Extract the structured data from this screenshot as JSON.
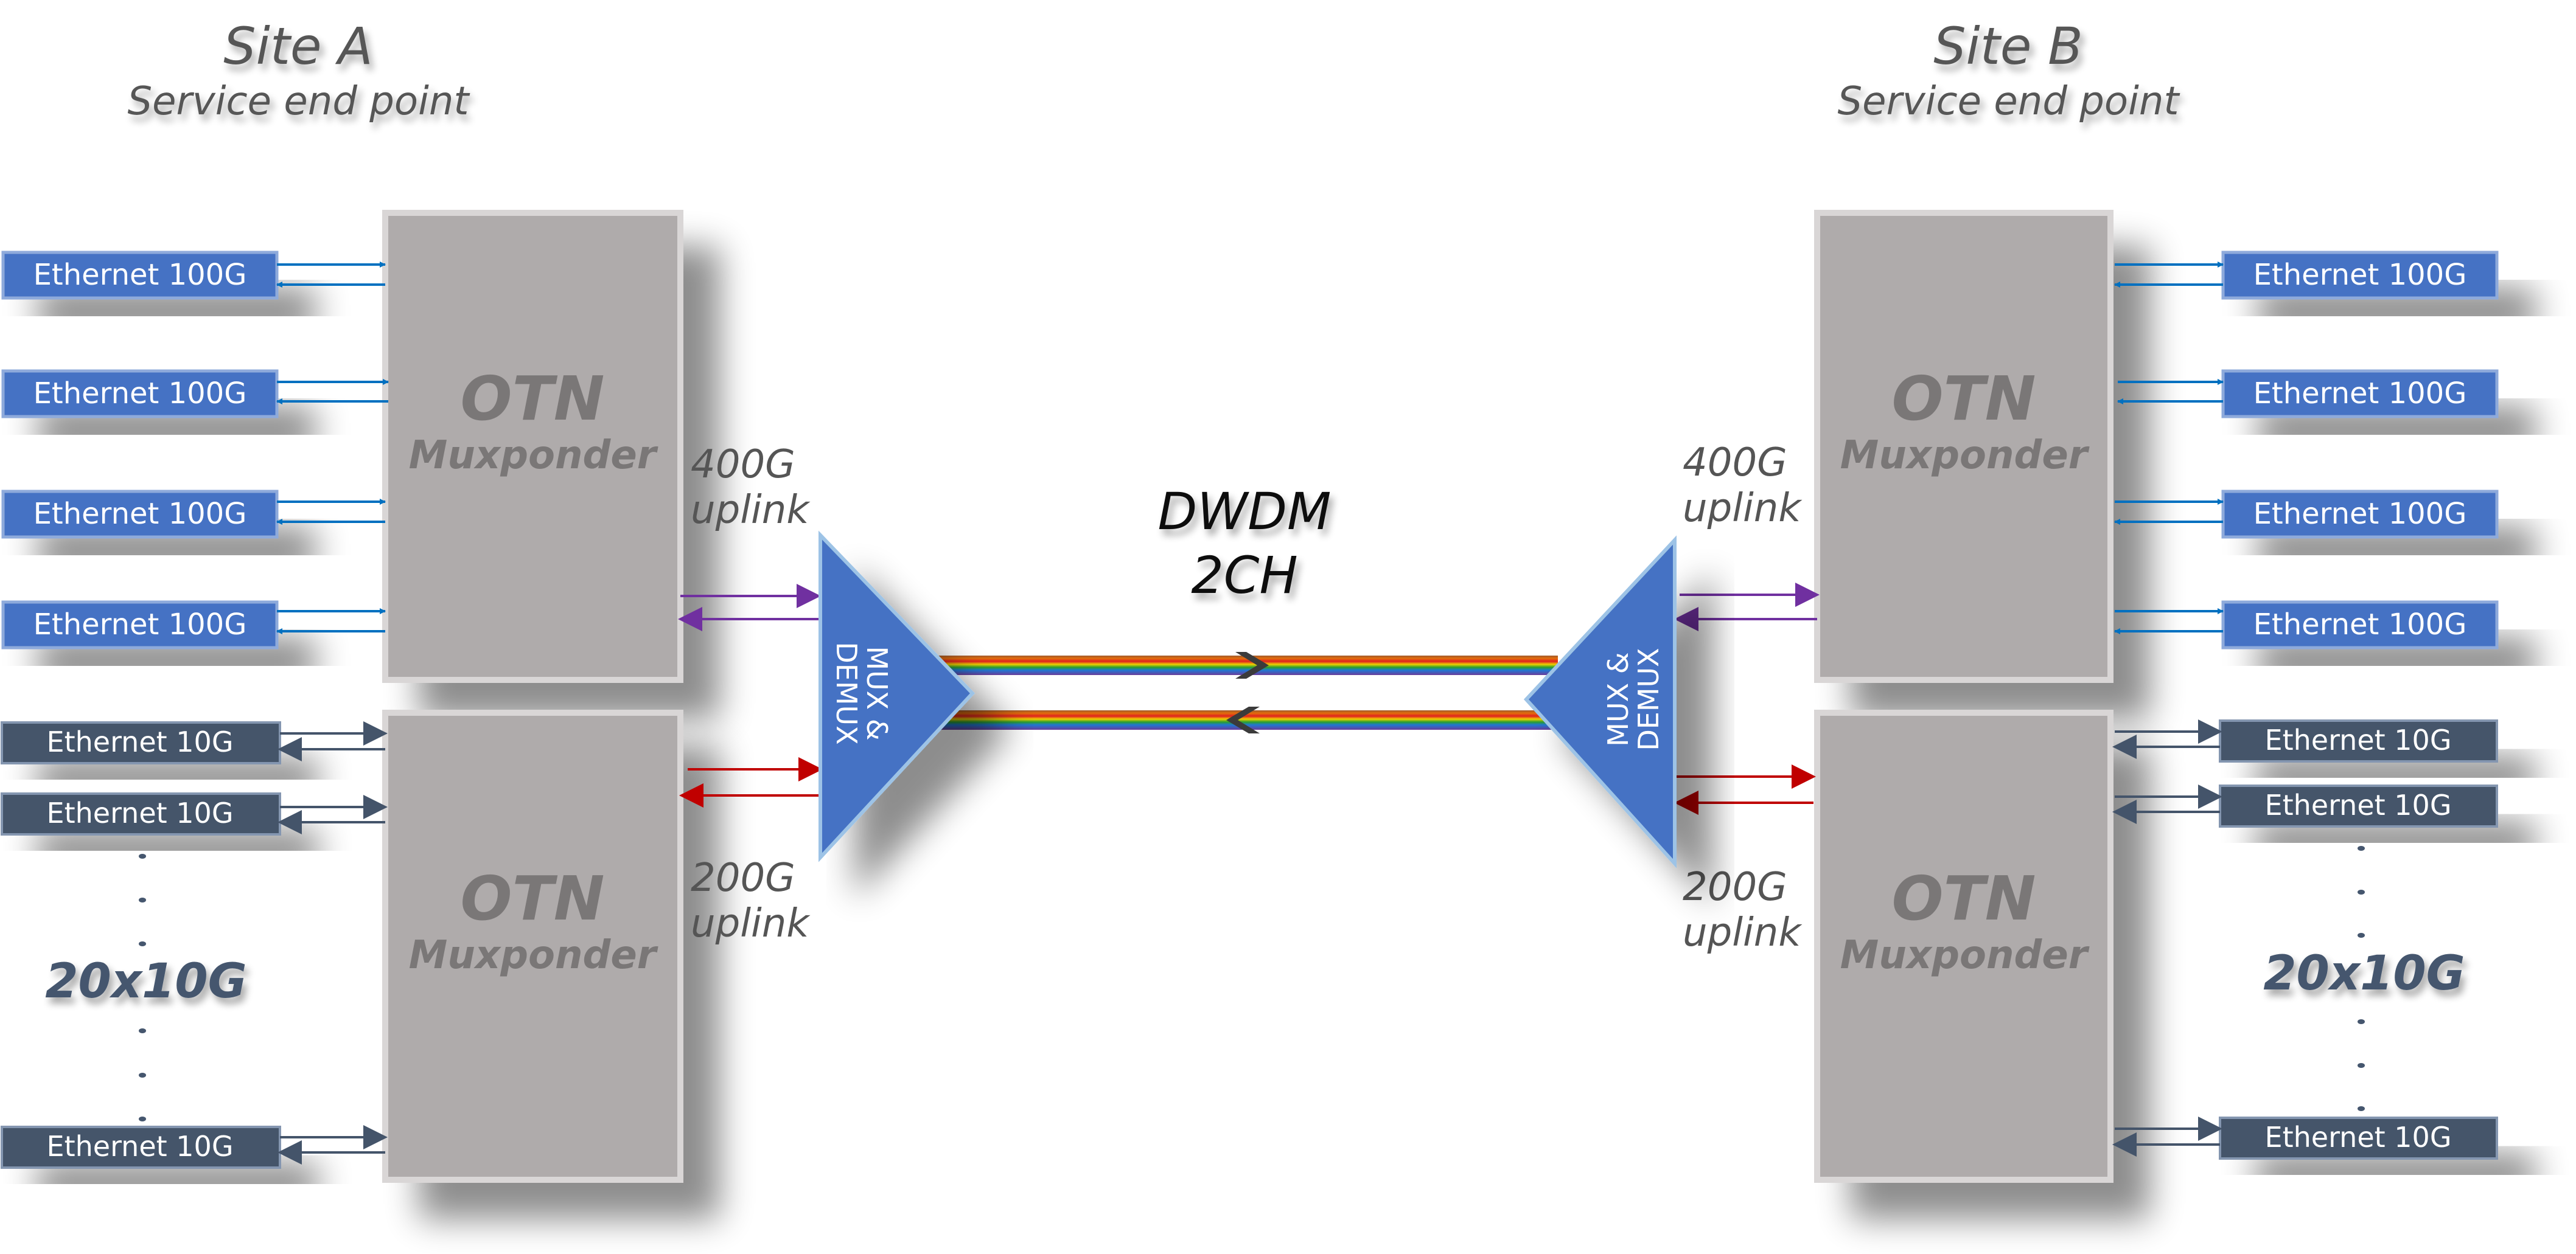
{
  "sites": [
    {
      "name": "Site A",
      "subtitle": "Service end point"
    },
    {
      "name": "Site B",
      "subtitle": "Service end point"
    }
  ],
  "muxponder": {
    "line1": "OTN",
    "line2": "Muxponder"
  },
  "clients": {
    "eth100": "Ethernet 100G",
    "eth10": "Ethernet 10G",
    "count_10g": "20x10G"
  },
  "uplinks": {
    "u400_line1": "400G",
    "u400_line2": "uplink",
    "u200_line1": "200G",
    "u200_line2": "uplink"
  },
  "mux_demux": {
    "line1": "MUX &",
    "line2": "DEMUX"
  },
  "dwdm": {
    "line1": "DWDM",
    "line2": "2CH"
  },
  "colors": {
    "eth100": "#4472c4",
    "eth10": "#44546a",
    "otn": "#afabab",
    "arrow100": "#0070c0",
    "arrow10": "#44546a",
    "arrow400": "#7030a0",
    "arrow200": "#c00000",
    "mux": "#4472c4"
  }
}
